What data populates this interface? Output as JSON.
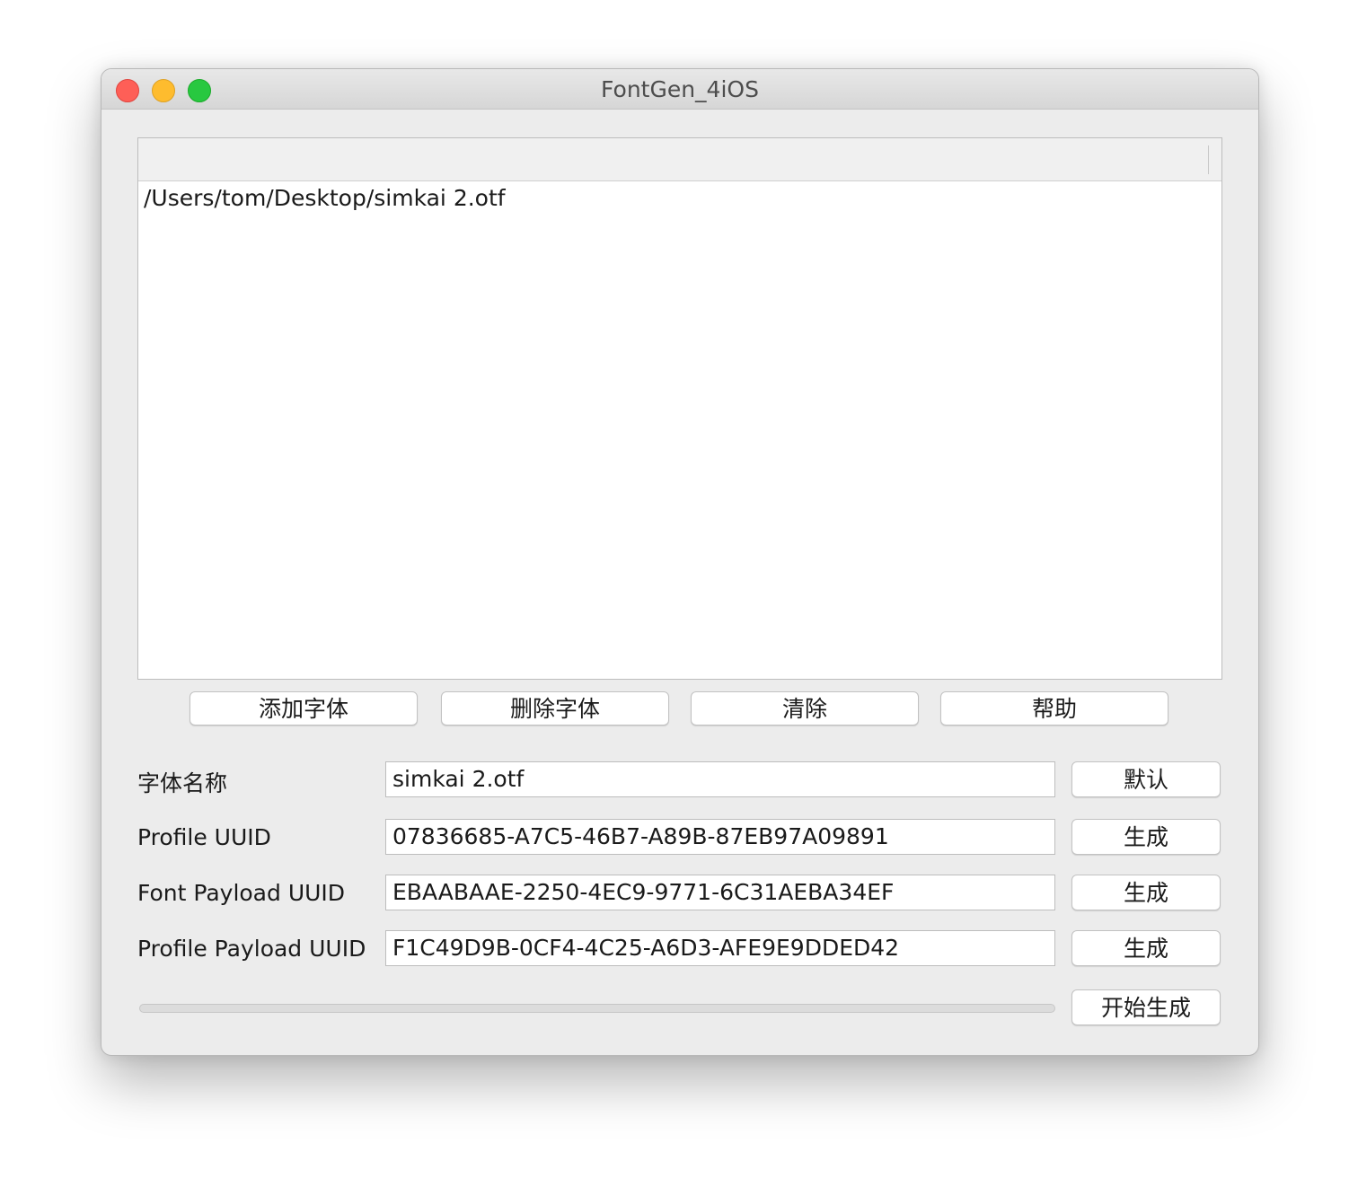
{
  "window": {
    "title": "FontGen_4iOS"
  },
  "file_list": {
    "items": [
      "/Users/tom/Desktop/simkai 2.otf"
    ]
  },
  "actions": {
    "add_font": "添加字体",
    "remove_font": "删除字体",
    "clear": "清除",
    "help": "帮助"
  },
  "form": {
    "font_name": {
      "label": "字体名称",
      "value": "simkai 2.otf",
      "button": "默认"
    },
    "profile_uuid": {
      "label": "Profile UUID",
      "value": "07836685-A7C5-46B7-A89B-87EB97A09891",
      "button": "生成"
    },
    "font_payload_uuid": {
      "label": "Font Payload UUID",
      "value": "EBAABAAE-2250-4EC9-9771-6C31AEBA34EF",
      "button": "生成"
    },
    "profile_payload_uuid": {
      "label": "Profile Payload UUID",
      "value": "F1C49D9B-0CF4-4C25-A6D3-AFE9E9DDED42",
      "button": "生成"
    }
  },
  "progress": {
    "value": 0,
    "start_button": "开始生成"
  }
}
